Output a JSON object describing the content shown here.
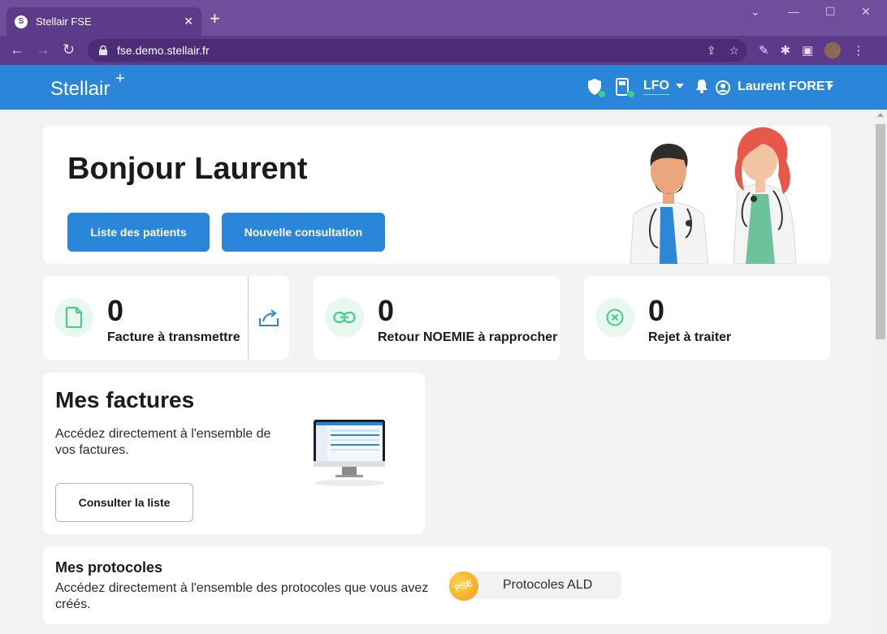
{
  "browser": {
    "tab_title": "Stellair FSE",
    "favicon_letter": "S",
    "url": "fse.demo.stellair.fr"
  },
  "header": {
    "logo": "Stellair",
    "logo_star": "+",
    "center_code": "LFO",
    "user_name": "Laurent FORET"
  },
  "hero": {
    "greeting": "Bonjour Laurent",
    "btn_patients": "Liste des patients",
    "btn_consultation": "Nouvelle consultation"
  },
  "stats": [
    {
      "value": "0",
      "label": "Facture à transmettre",
      "icon": "file-icon"
    },
    {
      "value": "0",
      "label": "Retour NOEMIE à rapprocher",
      "icon": "link-icon"
    },
    {
      "value": "0",
      "label": "Rejet à traiter",
      "icon": "x-circle-icon"
    }
  ],
  "factures": {
    "title": "Mes factures",
    "description": "Accédez directement à l'ensemble de vos factures.",
    "button": "Consulter la liste"
  },
  "protocoles": {
    "title": "Mes protocoles",
    "description": "Accédez directement à l'ensemble des protocoles que vous avez créés.",
    "ald_button": "Protocoles ALD",
    "badge": "PSE"
  },
  "colors": {
    "brand_blue": "#2a86d9",
    "chrome_purple": "#5b3b8a",
    "icon_green": "#3bd18a"
  }
}
